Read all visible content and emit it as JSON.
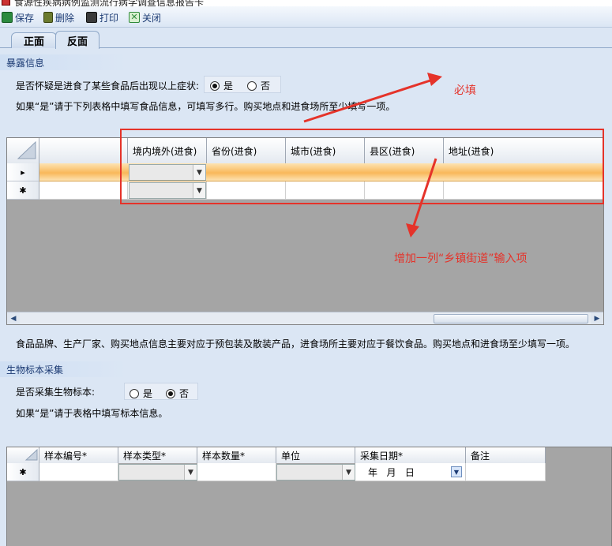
{
  "window": {
    "title": "食源性疾病病例监测流行病学调查信息报告卡"
  },
  "toolbar": {
    "save": "保存",
    "delete": "删除",
    "print": "打印",
    "close": "关闭"
  },
  "tabs": [
    {
      "label": "正面"
    },
    {
      "label": "反面"
    }
  ],
  "exposure": {
    "title": "暴露信息",
    "question": "是否怀疑是进食了某些食品后出现以上症状:",
    "yes": "是",
    "no": "否",
    "hint": "如果“是”请于下列表格中填写食品信息，可填写多行。购买地点和进食场所至少填写一项。",
    "columns": [
      "境内境外(进食)",
      "省份(进食)",
      "城市(进食)",
      "县区(进食)",
      "地址(进食)"
    ],
    "row_markers": [
      "▸",
      "✱"
    ],
    "footnote": "食品品牌、生产厂家、购买地点信息主要对应于预包装及散装产品，进食场所主要对应于餐饮食品。购买地点和进食场至少填写一项。"
  },
  "annotations": {
    "required": "必填",
    "add_column": "增加一列“乡镇街道”输入项"
  },
  "specimen": {
    "title": "生物标本采集",
    "question": "是否采集生物标本:",
    "yes": "是",
    "no": "否",
    "hint": "如果“是”请于表格中填写标本信息。",
    "columns": [
      "样本编号*",
      "样本类型*",
      "样本数量*",
      "单位",
      "采集日期*",
      "备注"
    ],
    "row_marker": "✱",
    "date_placeholder": "年   月   日"
  },
  "selection": {
    "exposure_answer": "是",
    "specimen_answer": "否"
  },
  "colors": {
    "accent_red": "#e5332a",
    "selected_row": "#fcd28f",
    "header_bg": "#dbe6f4"
  }
}
